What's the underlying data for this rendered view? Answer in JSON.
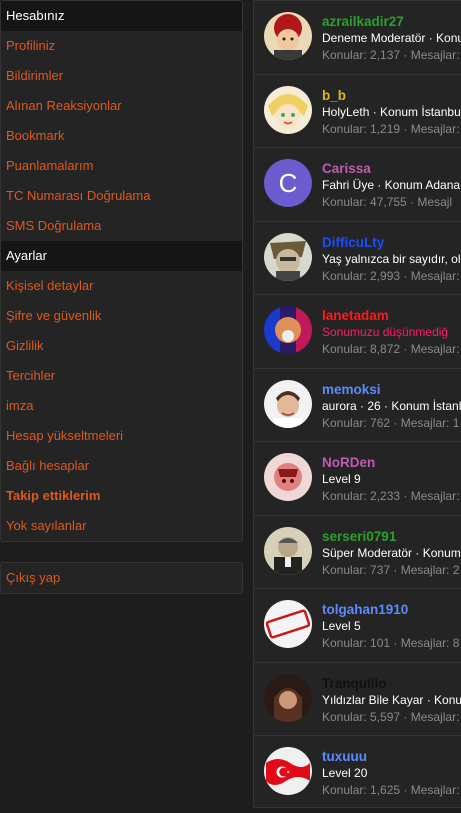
{
  "sidebar": {
    "account_header": "Hesabınız",
    "account_items": [
      "Profiliniz",
      "Bildirimler",
      "Alınan Reaksiyonlar",
      "Bookmark",
      "Puanlamalarım",
      "TC Numarası Doğrulama",
      "SMS Doğrulama"
    ],
    "settings_header": "Ayarlar",
    "settings_items": [
      "Kişisel detaylar",
      "Şifre ve güvenlik",
      "Gizlilik",
      "Tercihler",
      "imza",
      "Hesap yükseltmeleri",
      "Bağlı hesaplar",
      "Takip ettiklerim",
      "Yok sayılanlar"
    ],
    "logout": "Çıkış yap"
  },
  "members": [
    {
      "name": "azrailkadir27",
      "name_color": "#2ca02c",
      "title": "Deneme Moderatör · Konum",
      "stats": "Konular: 2,137 · Mesajlar:"
    },
    {
      "name": "b_b",
      "name_color": "#e0b51c",
      "title": "HolyLeth · Konum İstanbu",
      "stats": "Konular: 1,219 · Mesajlar:"
    },
    {
      "name": "Carissa",
      "name_color": "#c05bb2",
      "title": "Fahri Üye · Konum Adana",
      "stats": "Konular: 47,755 · Mesajl",
      "avatar_letter": "C"
    },
    {
      "name": "DifficuLty",
      "name_color": "#1a4cff",
      "title": "Yaş yalnızca bir sayıdır, ol",
      "stats": "Konular: 2,993 · Mesajlar:"
    },
    {
      "name": "lanetadam",
      "name_color": "#ff1a1a",
      "title": "Sonumuzu düşünmediğ",
      "title_color": "#ff1a6e",
      "stats": "Konular: 8,872 · Mesajlar:"
    },
    {
      "name": "memoksi",
      "name_color": "#5b8cff",
      "title": "aurora · 26 · Konum İstanb",
      "stats": "Konular: 762 · Mesajlar: 1"
    },
    {
      "name": "NoRDen",
      "name_color": "#c05bb2",
      "title": "Level 9",
      "stats": "Konular: 2,233 · Mesajlar:"
    },
    {
      "name": "serseri0791",
      "name_color": "#2ca02c",
      "title": "Süper Moderatör · Konum",
      "stats": "Konular: 737 · Mesajlar: 2"
    },
    {
      "name": "tolgahan1910",
      "name_color": "#5b8cff",
      "title": "Level 5",
      "stats": "Konular: 101 · Mesajlar: 8"
    },
    {
      "name": "Tranquillo",
      "name_color": "#111111",
      "title": "Yıldızlar Bile Kayar · Konu",
      "stats": "Konular: 5,597 · Mesajlar:"
    },
    {
      "name": "tuxuuu",
      "name_color": "#5b8cff",
      "title": "Level 20",
      "stats": "Konular: 1,625 · Mesajlar:"
    }
  ]
}
